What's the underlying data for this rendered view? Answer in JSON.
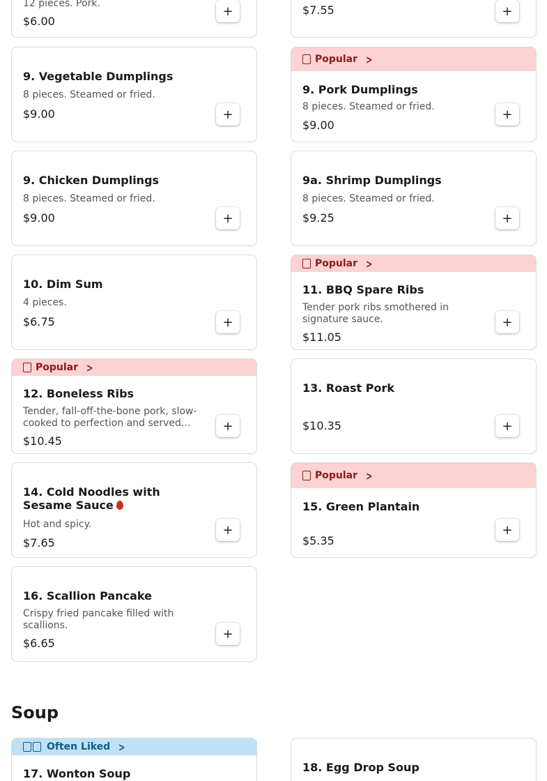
{
  "items": [
    {
      "badge": "",
      "title": "",
      "desc": "12 pieces. Pork.",
      "price": "$6.00"
    },
    {
      "badge": "",
      "title": "",
      "desc": "",
      "price": "$7.55"
    },
    {
      "badge": "",
      "title": "9. Vegetable Dumplings",
      "desc": "8 pieces. Steamed or fried.",
      "price": "$9.00"
    },
    {
      "badge": "Popular",
      "title": "9. Pork Dumplings",
      "desc": "8 pieces. Steamed or fried.",
      "price": "$9.00"
    },
    {
      "badge": "",
      "title": "9. Chicken Dumplings",
      "desc": "8 pieces. Steamed or fried.",
      "price": "$9.00"
    },
    {
      "badge": "",
      "title": "9a. Shrimp Dumplings",
      "desc": "8 pieces. Steamed or fried.",
      "price": "$9.25"
    },
    {
      "badge": "",
      "title": "10. Dim Sum",
      "desc": "4 pieces.",
      "price": "$6.75"
    },
    {
      "badge": "Popular",
      "title": "11. BBQ Spare Ribs",
      "desc": "Tender pork ribs smothered in signature sauce.",
      "price": "$11.05"
    },
    {
      "badge": "Popular",
      "title": "12. Boneless Ribs",
      "desc": "Tender, fall-off-the-bone pork, slow-cooked to perfection and served…",
      "price": "$10.45"
    },
    {
      "badge": "",
      "title": "13. Roast Pork",
      "desc": "",
      "price": "$10.35"
    },
    {
      "badge": "",
      "title": "14. Cold Noodles with Sesame Sauce",
      "desc": "Hot and spicy.",
      "price": "$7.65"
    },
    {
      "badge": "Popular",
      "title": "15. Green Plantain",
      "desc": "",
      "price": "$5.35"
    },
    {
      "badge": "",
      "title": "16. Scallion Pancake",
      "desc": "Crispy fried pancake filled with scallions.",
      "price": "$6.65"
    },
    {
      "badge": "Often Liked",
      "title": "17. Wonton Soup",
      "desc": "",
      "price": ""
    },
    {
      "badge": "",
      "title": "18. Egg Drop Soup",
      "desc": "",
      "price": ""
    }
  ],
  "section": {
    "soup_title": "Soup"
  },
  "add_label": "+",
  "colors": {
    "popular_bg": "#fbd3d3",
    "often_liked_bg": "#bfe1f6",
    "spicy": "#c8321d"
  },
  "icons": {
    "badge_popular": "badge-icon",
    "chevron": "chevron-right-icon",
    "add": "plus-icon",
    "spicy": "fire-icon"
  }
}
